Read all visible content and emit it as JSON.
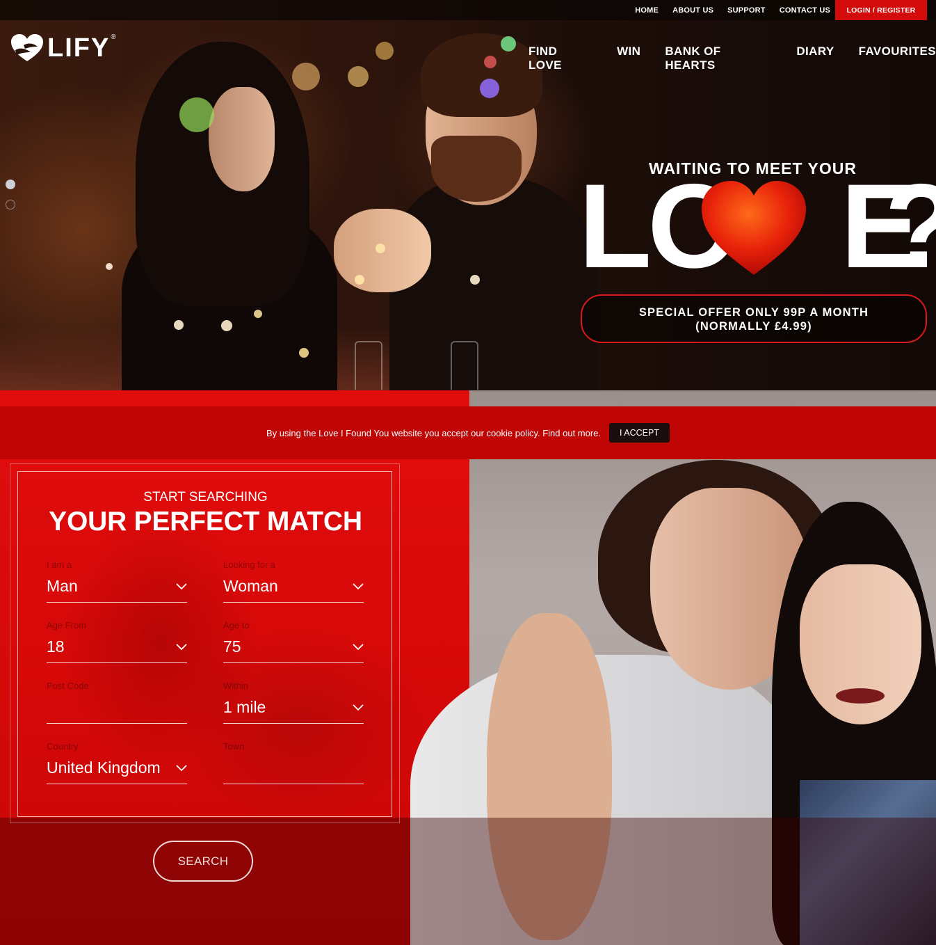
{
  "topbar": {
    "links": [
      "HOME",
      "ABOUT US",
      "SUPPORT",
      "CONTACT US"
    ],
    "login": "LOGIN / REGISTER"
  },
  "logo": {
    "text": "LIFY",
    "reg": "®"
  },
  "nav": [
    "FIND LOVE",
    "WIN",
    "BANK OF HEARTS",
    "DIARY",
    "FAVOURITES"
  ],
  "hero": {
    "waiting": "WAITING TO MEET YOUR",
    "love_prefix": "LO",
    "love_suffix": "E",
    "question": "?",
    "offer_line1": "SPECIAL OFFER ONLY 99P A MONTH",
    "offer_line2": "(NORMALLY £4.99)"
  },
  "cookie": {
    "message": "By using the Love I Found You website you accept our cookie policy. Find out more.",
    "accept": "I ACCEPT"
  },
  "search": {
    "kicker": "START SEARCHING",
    "headline": "YOUR PERFECT MATCH",
    "fields": {
      "iam": {
        "label": "I am a",
        "value": "Man"
      },
      "looking": {
        "label": "Looking for a",
        "value": "Woman"
      },
      "age_from": {
        "label": "Age From",
        "value": "18"
      },
      "age_to": {
        "label": "Age to",
        "value": "75"
      },
      "postcode": {
        "label": "Post Code",
        "value": ""
      },
      "within": {
        "label": "Within",
        "value": "1 mile"
      },
      "country": {
        "label": "Country",
        "value": "United Kingdom"
      },
      "town": {
        "label": "Town",
        "value": ""
      }
    },
    "button": "SEARCH"
  },
  "colors": {
    "brand_red": "#d40b0b",
    "cookie_red": "#c00505",
    "offer_border": "#d81a1a"
  }
}
